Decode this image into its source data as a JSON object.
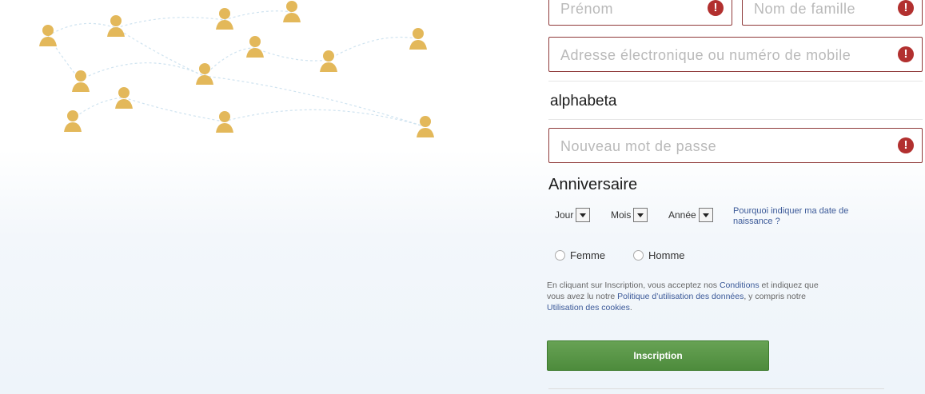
{
  "signup": {
    "first_name_placeholder": "Prénom",
    "last_name_placeholder": "Nom de famille",
    "email_placeholder": "Adresse électronique ou numéro de mobile",
    "reenter_value": "alphabeta",
    "password_placeholder": "Nouveau mot de passe",
    "error_glyph": "!",
    "birthday_title": "Anniversaire",
    "day_label": "Jour",
    "month_label": "Mois",
    "year_label": "Année",
    "why_birthday": "Pourquoi indiquer ma date de naissance ?",
    "female_label": "Femme",
    "male_label": "Homme",
    "legal_1": "En cliquant sur Inscription, vous acceptez nos ",
    "legal_link_terms": "Conditions",
    "legal_2": " et indiquez que vous avez lu notre ",
    "legal_link_policy": "Politique d’utilisation des données",
    "legal_3": ", y compris notre ",
    "legal_link_cookies": "Utilisation des cookies",
    "legal_4": ".",
    "submit_label": "Inscription"
  },
  "colors": {
    "error_border": "#8f3a3a",
    "error_icon": "#b2302f",
    "submit_green": "#4d8b3c",
    "link_blue": "#3b5998",
    "person_icon": "#e3b85a"
  },
  "icons": {
    "person": "person-icon",
    "error": "error-icon",
    "dropdown": "chevron-down-icon"
  }
}
